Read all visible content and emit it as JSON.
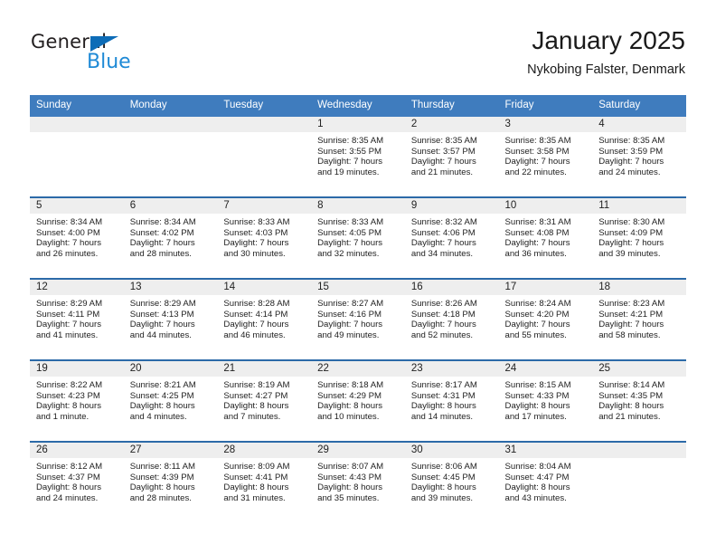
{
  "brand": {
    "name_part1": "General",
    "name_part2": "Blue",
    "triangle_color": "#0d6cb7",
    "blue_color": "#1f8ad6"
  },
  "header": {
    "month_title": "January 2025",
    "location": "Nykobing Falster, Denmark"
  },
  "theme": {
    "header_blue": "#3f7cbe",
    "row_rule_blue": "#2c6aa8",
    "daynum_band": "#eeeeee"
  },
  "calendar": {
    "weekday_headers": [
      "Sunday",
      "Monday",
      "Tuesday",
      "Wednesday",
      "Thursday",
      "Friday",
      "Saturday"
    ],
    "weeks": [
      [
        {
          "day": "",
          "empty": true
        },
        {
          "day": "",
          "empty": true
        },
        {
          "day": "",
          "empty": true
        },
        {
          "day": "1",
          "sunrise": "Sunrise: 8:35 AM",
          "sunset": "Sunset: 3:55 PM",
          "daylight_line1": "Daylight: 7 hours",
          "daylight_line2": "and 19 minutes."
        },
        {
          "day": "2",
          "sunrise": "Sunrise: 8:35 AM",
          "sunset": "Sunset: 3:57 PM",
          "daylight_line1": "Daylight: 7 hours",
          "daylight_line2": "and 21 minutes."
        },
        {
          "day": "3",
          "sunrise": "Sunrise: 8:35 AM",
          "sunset": "Sunset: 3:58 PM",
          "daylight_line1": "Daylight: 7 hours",
          "daylight_line2": "and 22 minutes."
        },
        {
          "day": "4",
          "sunrise": "Sunrise: 8:35 AM",
          "sunset": "Sunset: 3:59 PM",
          "daylight_line1": "Daylight: 7 hours",
          "daylight_line2": "and 24 minutes."
        }
      ],
      [
        {
          "day": "5",
          "sunrise": "Sunrise: 8:34 AM",
          "sunset": "Sunset: 4:00 PM",
          "daylight_line1": "Daylight: 7 hours",
          "daylight_line2": "and 26 minutes."
        },
        {
          "day": "6",
          "sunrise": "Sunrise: 8:34 AM",
          "sunset": "Sunset: 4:02 PM",
          "daylight_line1": "Daylight: 7 hours",
          "daylight_line2": "and 28 minutes."
        },
        {
          "day": "7",
          "sunrise": "Sunrise: 8:33 AM",
          "sunset": "Sunset: 4:03 PM",
          "daylight_line1": "Daylight: 7 hours",
          "daylight_line2": "and 30 minutes."
        },
        {
          "day": "8",
          "sunrise": "Sunrise: 8:33 AM",
          "sunset": "Sunset: 4:05 PM",
          "daylight_line1": "Daylight: 7 hours",
          "daylight_line2": "and 32 minutes."
        },
        {
          "day": "9",
          "sunrise": "Sunrise: 8:32 AM",
          "sunset": "Sunset: 4:06 PM",
          "daylight_line1": "Daylight: 7 hours",
          "daylight_line2": "and 34 minutes."
        },
        {
          "day": "10",
          "sunrise": "Sunrise: 8:31 AM",
          "sunset": "Sunset: 4:08 PM",
          "daylight_line1": "Daylight: 7 hours",
          "daylight_line2": "and 36 minutes."
        },
        {
          "day": "11",
          "sunrise": "Sunrise: 8:30 AM",
          "sunset": "Sunset: 4:09 PM",
          "daylight_line1": "Daylight: 7 hours",
          "daylight_line2": "and 39 minutes."
        }
      ],
      [
        {
          "day": "12",
          "sunrise": "Sunrise: 8:29 AM",
          "sunset": "Sunset: 4:11 PM",
          "daylight_line1": "Daylight: 7 hours",
          "daylight_line2": "and 41 minutes."
        },
        {
          "day": "13",
          "sunrise": "Sunrise: 8:29 AM",
          "sunset": "Sunset: 4:13 PM",
          "daylight_line1": "Daylight: 7 hours",
          "daylight_line2": "and 44 minutes."
        },
        {
          "day": "14",
          "sunrise": "Sunrise: 8:28 AM",
          "sunset": "Sunset: 4:14 PM",
          "daylight_line1": "Daylight: 7 hours",
          "daylight_line2": "and 46 minutes."
        },
        {
          "day": "15",
          "sunrise": "Sunrise: 8:27 AM",
          "sunset": "Sunset: 4:16 PM",
          "daylight_line1": "Daylight: 7 hours",
          "daylight_line2": "and 49 minutes."
        },
        {
          "day": "16",
          "sunrise": "Sunrise: 8:26 AM",
          "sunset": "Sunset: 4:18 PM",
          "daylight_line1": "Daylight: 7 hours",
          "daylight_line2": "and 52 minutes."
        },
        {
          "day": "17",
          "sunrise": "Sunrise: 8:24 AM",
          "sunset": "Sunset: 4:20 PM",
          "daylight_line1": "Daylight: 7 hours",
          "daylight_line2": "and 55 minutes."
        },
        {
          "day": "18",
          "sunrise": "Sunrise: 8:23 AM",
          "sunset": "Sunset: 4:21 PM",
          "daylight_line1": "Daylight: 7 hours",
          "daylight_line2": "and 58 minutes."
        }
      ],
      [
        {
          "day": "19",
          "sunrise": "Sunrise: 8:22 AM",
          "sunset": "Sunset: 4:23 PM",
          "daylight_line1": "Daylight: 8 hours",
          "daylight_line2": "and 1 minute."
        },
        {
          "day": "20",
          "sunrise": "Sunrise: 8:21 AM",
          "sunset": "Sunset: 4:25 PM",
          "daylight_line1": "Daylight: 8 hours",
          "daylight_line2": "and 4 minutes."
        },
        {
          "day": "21",
          "sunrise": "Sunrise: 8:19 AM",
          "sunset": "Sunset: 4:27 PM",
          "daylight_line1": "Daylight: 8 hours",
          "daylight_line2": "and 7 minutes."
        },
        {
          "day": "22",
          "sunrise": "Sunrise: 8:18 AM",
          "sunset": "Sunset: 4:29 PM",
          "daylight_line1": "Daylight: 8 hours",
          "daylight_line2": "and 10 minutes."
        },
        {
          "day": "23",
          "sunrise": "Sunrise: 8:17 AM",
          "sunset": "Sunset: 4:31 PM",
          "daylight_line1": "Daylight: 8 hours",
          "daylight_line2": "and 14 minutes."
        },
        {
          "day": "24",
          "sunrise": "Sunrise: 8:15 AM",
          "sunset": "Sunset: 4:33 PM",
          "daylight_line1": "Daylight: 8 hours",
          "daylight_line2": "and 17 minutes."
        },
        {
          "day": "25",
          "sunrise": "Sunrise: 8:14 AM",
          "sunset": "Sunset: 4:35 PM",
          "daylight_line1": "Daylight: 8 hours",
          "daylight_line2": "and 21 minutes."
        }
      ],
      [
        {
          "day": "26",
          "sunrise": "Sunrise: 8:12 AM",
          "sunset": "Sunset: 4:37 PM",
          "daylight_line1": "Daylight: 8 hours",
          "daylight_line2": "and 24 minutes."
        },
        {
          "day": "27",
          "sunrise": "Sunrise: 8:11 AM",
          "sunset": "Sunset: 4:39 PM",
          "daylight_line1": "Daylight: 8 hours",
          "daylight_line2": "and 28 minutes."
        },
        {
          "day": "28",
          "sunrise": "Sunrise: 8:09 AM",
          "sunset": "Sunset: 4:41 PM",
          "daylight_line1": "Daylight: 8 hours",
          "daylight_line2": "and 31 minutes."
        },
        {
          "day": "29",
          "sunrise": "Sunrise: 8:07 AM",
          "sunset": "Sunset: 4:43 PM",
          "daylight_line1": "Daylight: 8 hours",
          "daylight_line2": "and 35 minutes."
        },
        {
          "day": "30",
          "sunrise": "Sunrise: 8:06 AM",
          "sunset": "Sunset: 4:45 PM",
          "daylight_line1": "Daylight: 8 hours",
          "daylight_line2": "and 39 minutes."
        },
        {
          "day": "31",
          "sunrise": "Sunrise: 8:04 AM",
          "sunset": "Sunset: 4:47 PM",
          "daylight_line1": "Daylight: 8 hours",
          "daylight_line2": "and 43 minutes."
        },
        {
          "day": "",
          "empty": true
        }
      ]
    ]
  }
}
